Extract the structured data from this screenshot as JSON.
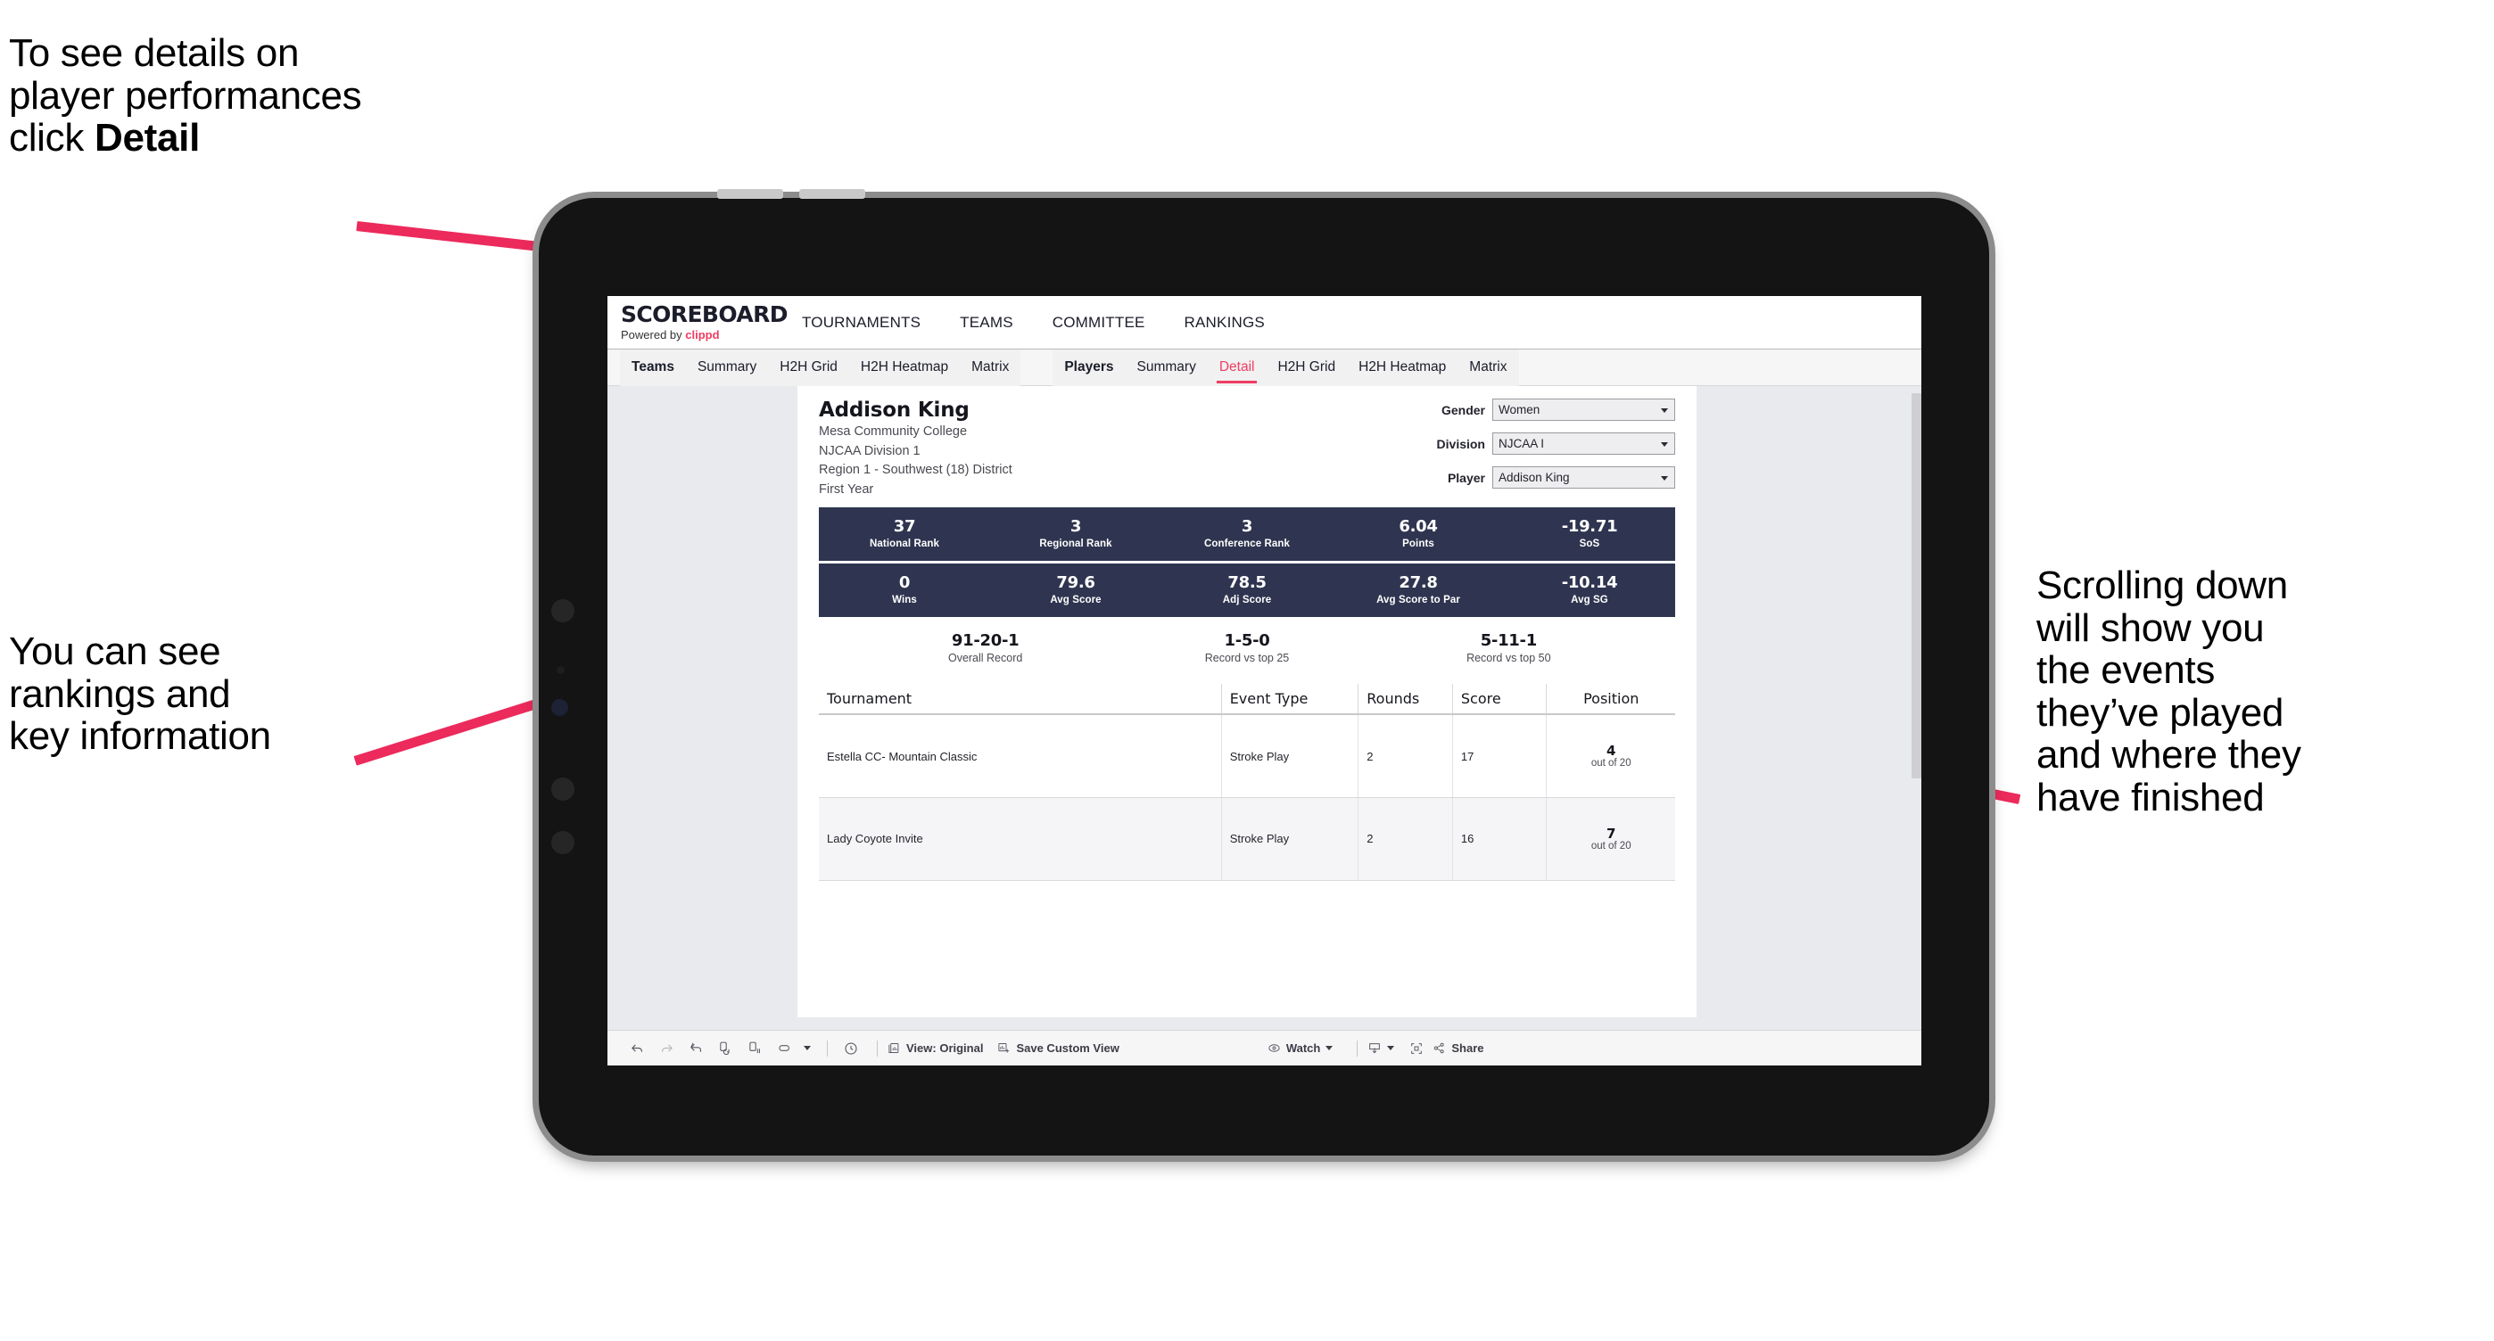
{
  "annotations": {
    "top_left": "To see details on\nplayer performances\nclick ",
    "top_left_bold": "Detail",
    "mid_left": "You can see\nrankings and\nkey information",
    "right": "Scrolling down\nwill show you\nthe events\nthey’ve played\nand where they\nhave finished",
    "arrow_color": "#ec2a5c"
  },
  "app": {
    "brand_name": "SCOREBOARD",
    "brand_sub_prefix": "Powered by",
    "brand_sub_name": "clippd",
    "top_nav": [
      "TOURNAMENTS",
      "TEAMS",
      "COMMITTEE",
      "RANKINGS"
    ],
    "sub_nav_teams": [
      "Teams",
      "Summary",
      "H2H Grid",
      "H2H Heatmap",
      "Matrix"
    ],
    "sub_nav_players": [
      "Players",
      "Summary",
      "Detail",
      "H2H Grid",
      "H2H Heatmap",
      "Matrix"
    ],
    "active_sub_tab": "Detail"
  },
  "player": {
    "name": "Addison King",
    "school": "Mesa Community College",
    "division": "NJCAA Division 1",
    "region": "Region 1 - Southwest (18) District",
    "year": "First Year"
  },
  "filters": [
    {
      "label": "Gender",
      "value": "Women"
    },
    {
      "label": "Division",
      "value": "NJCAA I"
    },
    {
      "label": "Player",
      "value": "Addison King"
    }
  ],
  "stats_row_1": [
    {
      "value": "37",
      "label": "National Rank"
    },
    {
      "value": "3",
      "label": "Regional Rank"
    },
    {
      "value": "3",
      "label": "Conference Rank"
    },
    {
      "value": "6.04",
      "label": "Points"
    },
    {
      "value": "-19.71",
      "label": "SoS"
    }
  ],
  "stats_row_2": [
    {
      "value": "0",
      "label": "Wins"
    },
    {
      "value": "79.6",
      "label": "Avg Score"
    },
    {
      "value": "78.5",
      "label": "Adj Score"
    },
    {
      "value": "27.8",
      "label": "Avg Score to Par"
    },
    {
      "value": "-10.14",
      "label": "Avg SG"
    }
  ],
  "records": [
    {
      "value": "91-20-1",
      "label": "Overall Record"
    },
    {
      "value": "1-5-0",
      "label": "Record vs top 25"
    },
    {
      "value": "5-11-1",
      "label": "Record vs top 50"
    }
  ],
  "events_table": {
    "columns": [
      "Tournament",
      "Event Type",
      "Rounds",
      "Score",
      "Position"
    ],
    "rows": [
      {
        "tournament": "Estella CC- Mountain Classic",
        "event_type": "Stroke Play",
        "rounds": "2",
        "score": "17",
        "position": "4",
        "position_out_of": "out of 20"
      },
      {
        "tournament": "Lady Coyote Invite",
        "event_type": "Stroke Play",
        "rounds": "2",
        "score": "16",
        "position": "7",
        "position_out_of": "out of 20"
      }
    ]
  },
  "toolbar": {
    "icons": [
      "undo-icon",
      "redo-icon",
      "revert-icon",
      "refresh-data-icon",
      "pause-auto-update-icon",
      "loop-icon",
      "chevron-down-icon",
      "clock-history-icon"
    ],
    "view_label": "View: Original",
    "save_custom_view_label": "Save Custom View",
    "watch_label": "Watch",
    "share_label": "Share"
  },
  "colors": {
    "accent_pink": "#ef3d62",
    "stat_navy": "#2f3550",
    "page_bg": "#e9eaed",
    "arrow": "#ec2a5c"
  }
}
